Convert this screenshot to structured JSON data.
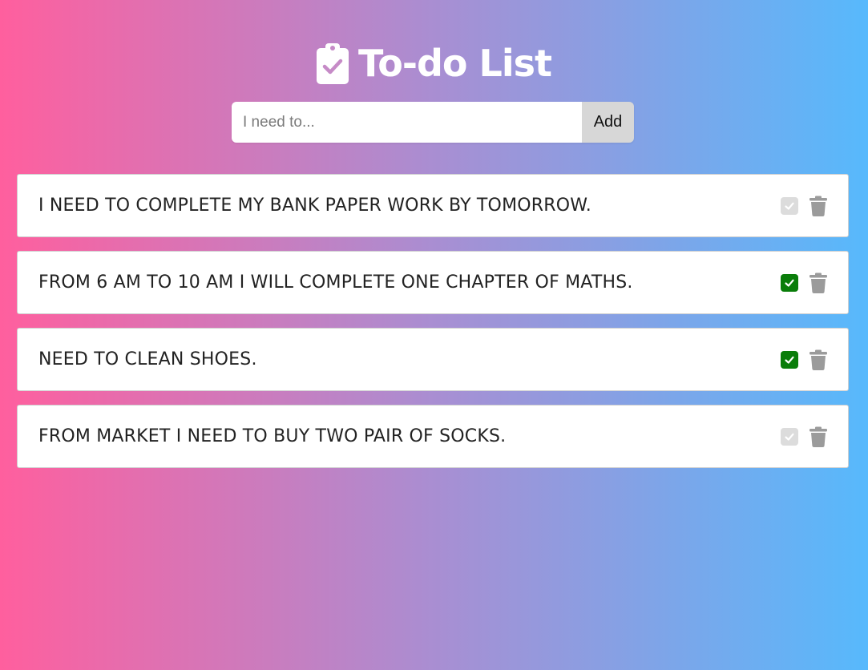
{
  "header": {
    "icon": "clipboard-check-icon",
    "title": "To-do List"
  },
  "add_form": {
    "placeholder": "I need to...",
    "value": "",
    "button_label": "Add"
  },
  "colors": {
    "gradient_start": "#ff5f9e",
    "gradient_end": "#57b9fc",
    "done_check": "#0a7d0a",
    "pending_check": "#dcdcdc",
    "trash": "#9b9b9b"
  },
  "todos": [
    {
      "text": "I need to complete my bank paper work by tomorrow.",
      "done": false,
      "check_icon": "check-icon",
      "delete_icon": "trash-icon"
    },
    {
      "text": "From 6 am to 10 am I will complete one chapter of maths.",
      "done": true,
      "check_icon": "check-icon",
      "delete_icon": "trash-icon"
    },
    {
      "text": "Need to clean shoes.",
      "done": true,
      "check_icon": "check-icon",
      "delete_icon": "trash-icon"
    },
    {
      "text": "From market I need to buy two pair of socks.",
      "done": false,
      "check_icon": "check-icon",
      "delete_icon": "trash-icon"
    }
  ]
}
